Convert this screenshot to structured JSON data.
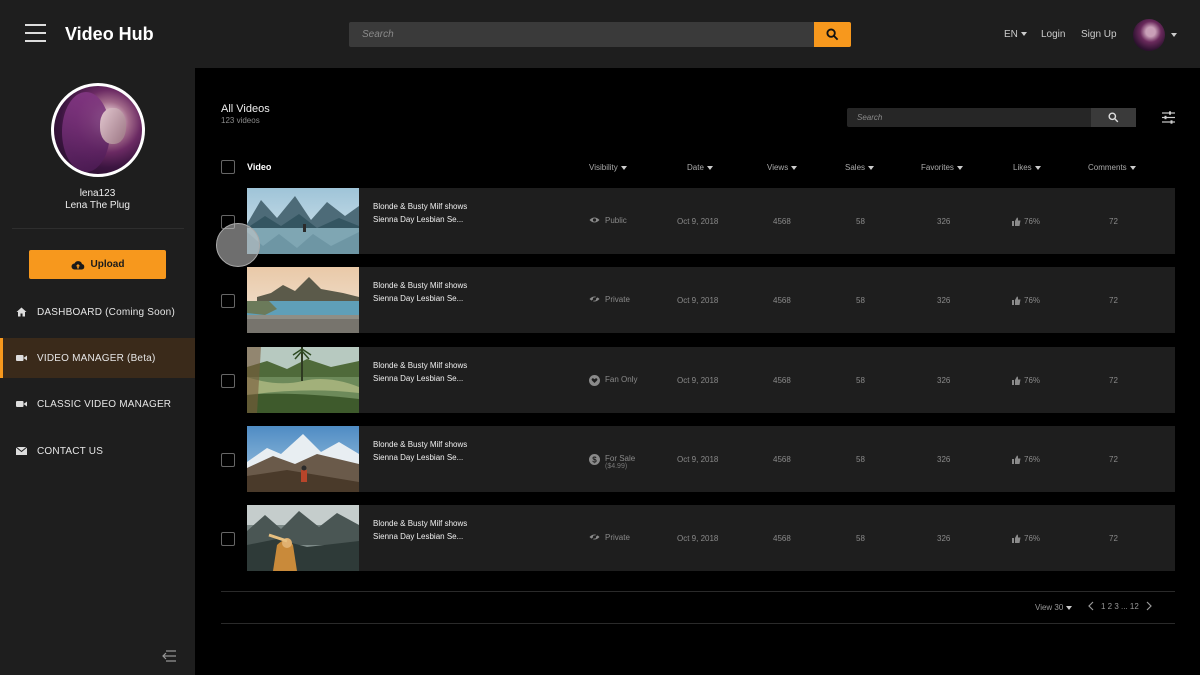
{
  "app": {
    "title": "Video Hub",
    "search_placeholder": "Search",
    "language": "EN",
    "login": "Login",
    "signup": "Sign Up"
  },
  "sidebar": {
    "username": "lena123",
    "display_name": "Lena The Plug",
    "upload_label": "Upload",
    "items": [
      {
        "label": "DASHBOARD (Coming Soon)",
        "icon": "home-icon"
      },
      {
        "label": "VIDEO MANAGER (Beta)",
        "icon": "video-camera-icon",
        "active": true
      },
      {
        "label": "CLASSIC VIDEO MANAGER",
        "icon": "video-camera-icon"
      },
      {
        "label": "CONTACT US",
        "icon": "envelope-icon"
      }
    ]
  },
  "main": {
    "title": "All Videos",
    "subtitle": "123 videos",
    "search_placeholder": "Search",
    "columns": {
      "video": "Video",
      "visibility": "Visibility",
      "date": "Date",
      "views": "Views",
      "sales": "Sales",
      "favorites": "Favorites",
      "likes": "Likes",
      "comments": "Comments"
    },
    "rows": [
      {
        "title1": "Blonde & Busty Milf shows",
        "title2": "Sienna Day Lesbian Se...",
        "visibility": "Public",
        "vis_icon": "eye-icon",
        "price": "",
        "date": "Oct 9, 2018",
        "views": "4568",
        "sales": "58",
        "favorites": "326",
        "likes": "76%",
        "comments": "72"
      },
      {
        "title1": "Blonde & Busty Milf shows",
        "title2": "Sienna Day Lesbian Se...",
        "visibility": "Private",
        "vis_icon": "eye-slash-icon",
        "price": "",
        "date": "Oct 9, 2018",
        "views": "4568",
        "sales": "58",
        "favorites": "326",
        "likes": "76%",
        "comments": "72"
      },
      {
        "title1": "Blonde & Busty Milf shows",
        "title2": "Sienna Day Lesbian Se...",
        "visibility": "Fan Only",
        "vis_icon": "heart-icon",
        "price": "",
        "date": "Oct 9, 2018",
        "views": "4568",
        "sales": "58",
        "favorites": "326",
        "likes": "76%",
        "comments": "72"
      },
      {
        "title1": "Blonde & Busty Milf shows",
        "title2": "Sienna Day Lesbian Se...",
        "visibility": "For Sale",
        "vis_icon": "dollar-icon",
        "price": "($4.99)",
        "date": "Oct 9, 2018",
        "views": "4568",
        "sales": "58",
        "favorites": "326",
        "likes": "76%",
        "comments": "72"
      },
      {
        "title1": "Blonde & Busty Milf shows",
        "title2": "Sienna Day Lesbian Se...",
        "visibility": "Private",
        "vis_icon": "eye-slash-icon",
        "price": "",
        "date": "Oct 9, 2018",
        "views": "4568",
        "sales": "58",
        "favorites": "326",
        "likes": "76%",
        "comments": "72"
      }
    ],
    "footer": {
      "view": "View 30",
      "pages": "1 2 3 ... 12"
    }
  },
  "colors": {
    "accent": "#f7981d",
    "panel": "#1e1e1e",
    "background": "#000000"
  }
}
